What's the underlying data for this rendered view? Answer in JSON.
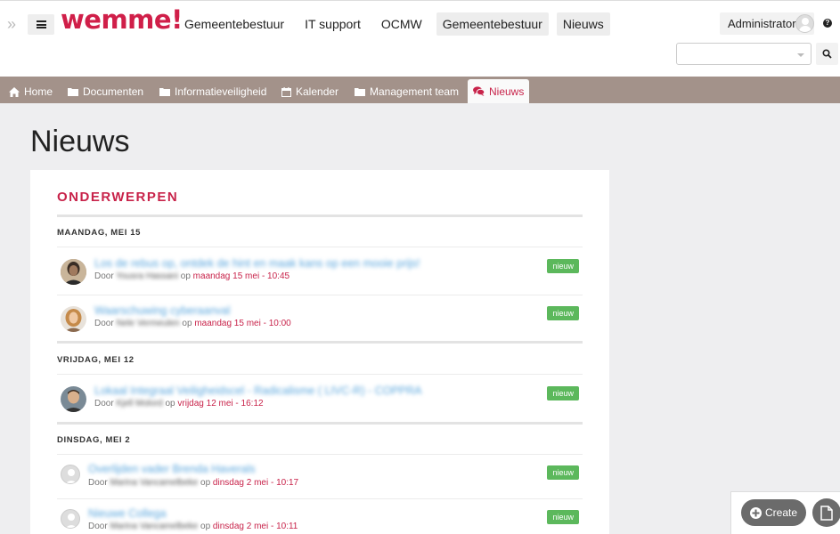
{
  "header": {
    "logo": "wemme!",
    "nav": [
      {
        "label": "Gemeentebestuur",
        "boxed": false
      },
      {
        "label": "IT support",
        "boxed": false
      },
      {
        "label": "OCMW",
        "boxed": false
      },
      {
        "label": "Gemeentebestuur",
        "boxed": true
      },
      {
        "label": "Nieuws",
        "boxed": true
      }
    ],
    "user": "Administrator",
    "help": "?",
    "search": {
      "value": "",
      "placeholder": ""
    }
  },
  "tabs": [
    {
      "label": "Home",
      "icon": "home-icon"
    },
    {
      "label": "Documenten",
      "icon": "folder-icon"
    },
    {
      "label": "Informatieveiligheid",
      "icon": "folder-icon"
    },
    {
      "label": "Kalender",
      "icon": "calendar-icon"
    },
    {
      "label": "Management team",
      "icon": "folder-icon"
    },
    {
      "label": "Nieuws",
      "icon": "comments-icon",
      "active": true
    }
  ],
  "page": {
    "title": "Nieuws",
    "section_title": "ONDERWERPEN"
  },
  "groups": [
    {
      "day": "MAANDAG, MEI 15",
      "items": [
        {
          "title": "Los de rebus op, ontdek de hint en maak kans op een mooie prijs!",
          "by_label": "Door",
          "author": "Yousra Hassani",
          "on_label": "op",
          "date": "maandag 15 mei - 10:45",
          "badge": "nieuw",
          "avatar": "photo-dark"
        },
        {
          "title": "Waarschuwing cyberaanval",
          "by_label": "Door",
          "author": "Nele Vermeulen",
          "on_label": "op",
          "date": "maandag 15 mei - 10:00",
          "badge": "nieuw",
          "avatar": "photo-blond"
        }
      ]
    },
    {
      "day": "VRIJDAG, MEI 12",
      "items": [
        {
          "title": "Lokaal Integraal Veiligheidscel - Radicalisme ( LIVC-R) - COPPRA",
          "by_label": "Door",
          "author": "Kjell Molord",
          "on_label": "op",
          "date": "vrijdag 12 mei - 16:12",
          "badge": "nieuw",
          "avatar": "photo-man"
        }
      ]
    },
    {
      "day": "DINSDAG, MEI 2",
      "items": [
        {
          "title": "Overlijden vader Brenda Haverals",
          "by_label": "Door",
          "author": "Marina Vancamelbeke",
          "on_label": "op",
          "date": "dinsdag 2 mei - 10:17",
          "badge": "nieuw",
          "avatar": "placeholder"
        },
        {
          "title": "Nieuwe Collega",
          "by_label": "Door",
          "author": "Marina Vancamelbeke",
          "on_label": "op",
          "date": "dinsdag 2 mei - 10:11",
          "badge": "nieuw",
          "avatar": "placeholder"
        }
      ]
    }
  ],
  "tools": {
    "create_label": "Create"
  },
  "colors": {
    "accent": "#c8234a",
    "tabbar": "#a3928a",
    "badge": "#5cb85c",
    "link": "#5aa6dd"
  }
}
